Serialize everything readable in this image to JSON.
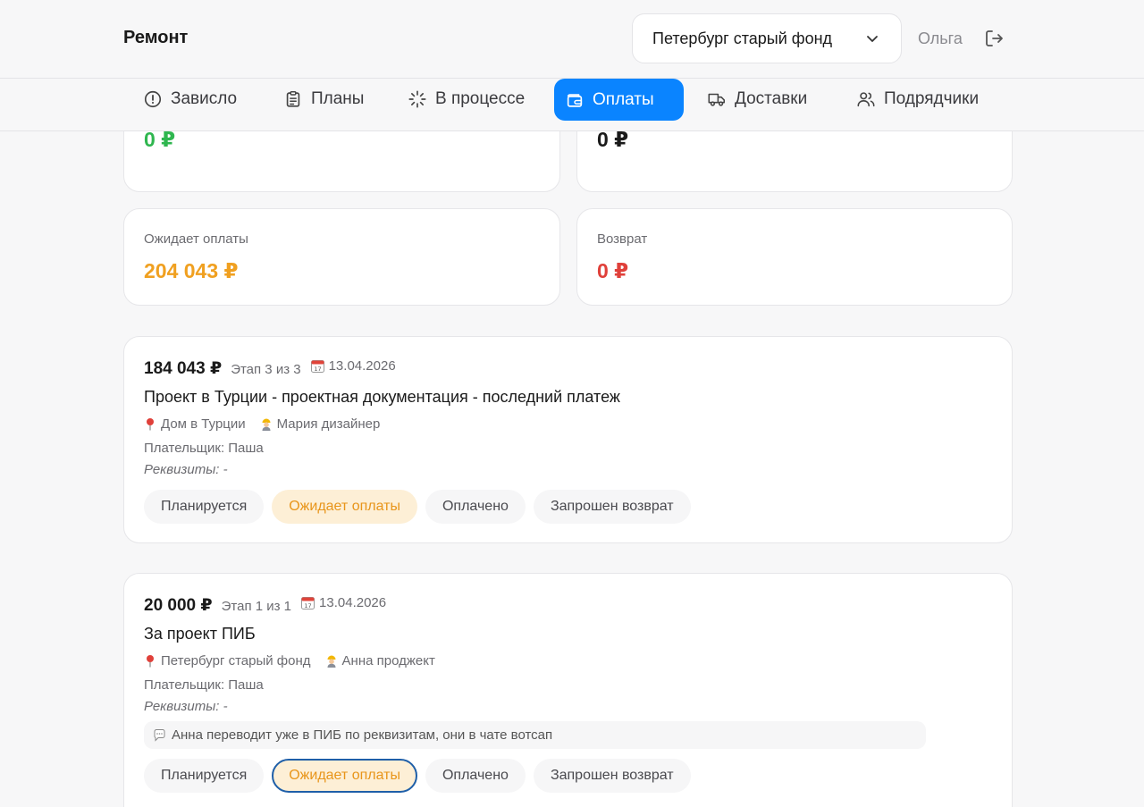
{
  "header": {
    "app_title": "Ремонт",
    "project": "Петербург старый фонд",
    "user": "Ольга"
  },
  "nav": {
    "tabs": [
      {
        "label": "Зависло",
        "icon": "alert-circle-icon",
        "active": false
      },
      {
        "label": "Планы",
        "icon": "clipboard-icon",
        "active": false
      },
      {
        "label": "В процессе",
        "icon": "loader-icon",
        "active": false
      },
      {
        "label": "Оплаты",
        "icon": "wallet-icon",
        "active": true
      },
      {
        "label": "Доставки",
        "icon": "truck-icon",
        "active": false
      },
      {
        "label": "Подрядчики",
        "icon": "users-icon",
        "active": false
      }
    ]
  },
  "summary": {
    "paid": {
      "value": "0 ₽",
      "color": "#2fb64f"
    },
    "second": {
      "value": "0 ₽",
      "color": "#1a1a1a"
    },
    "awaiting": {
      "label": "Ожидает оплаты",
      "value": "204 043 ₽",
      "color": "#f0a020"
    },
    "refund": {
      "label": "Возврат",
      "value": "0 ₽",
      "color": "#e0403a"
    }
  },
  "statuses": [
    "Планируется",
    "Ожидает оплаты",
    "Оплачено",
    "Запрошен возврат"
  ],
  "payments": [
    {
      "amount": "184 043 ₽",
      "stage": "Этап 3 из 3",
      "date": "13.04.2026",
      "title": "Проект в Турции - проектная документация - последний платеж",
      "location": "Дом в Турции",
      "contractor": "Мария дизайнер",
      "payer": "Плательщик: Паша",
      "requisites": "Реквизиты: -",
      "note": "",
      "selected_status": "Ожидает оплаты"
    },
    {
      "amount": "20 000 ₽",
      "stage": "Этап 1 из 1",
      "date": "13.04.2026",
      "title": "За проект ПИБ",
      "location": "Петербург старый фонд",
      "contractor": "Анна проджект",
      "payer": "Плательщик: Паша",
      "requisites": "Реквизиты: -",
      "note": "Анна переводит уже в ПИБ по реквизитам, они в чате вотсап",
      "selected_status": "Ожидает оплаты"
    }
  ]
}
